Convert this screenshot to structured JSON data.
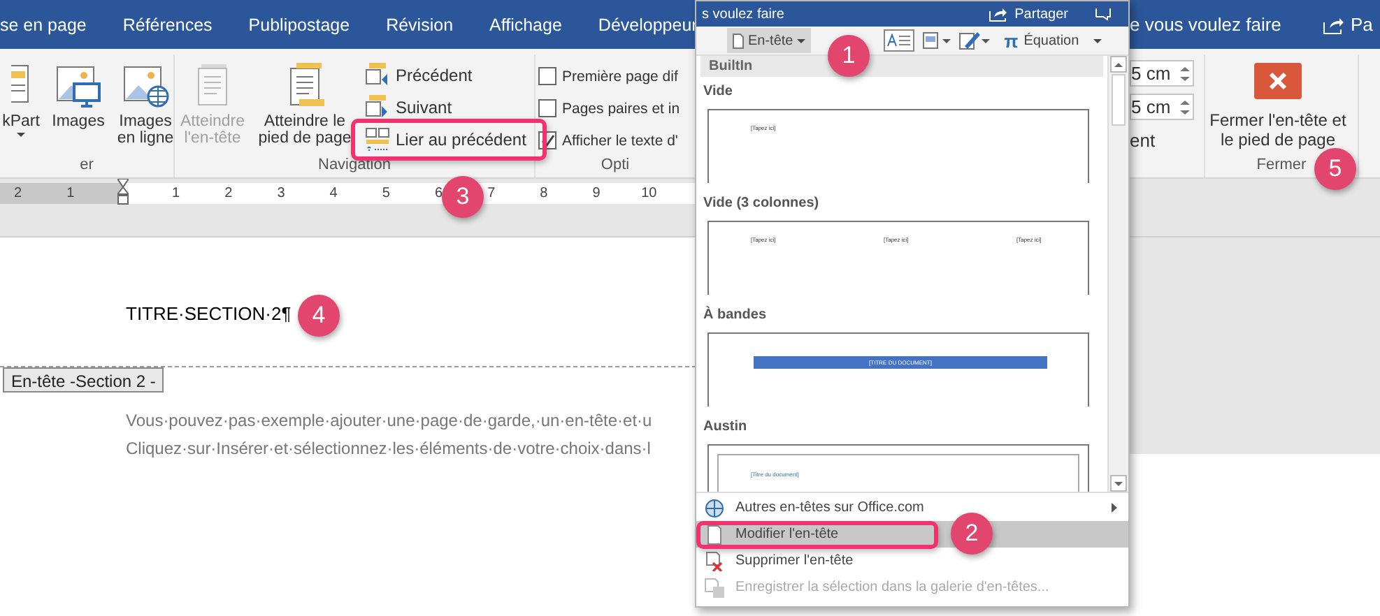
{
  "tabs": [
    {
      "label": "se en page"
    },
    {
      "label": "Références"
    },
    {
      "label": "Publipostage"
    },
    {
      "label": "Révision"
    },
    {
      "label": "Affichage"
    },
    {
      "label": "Développeur"
    }
  ],
  "tell_me": "e vous voulez faire",
  "share": "Pa",
  "ribbon": {
    "groups": [
      {
        "kind": "insert",
        "label": "er",
        "buttons": [
          {
            "label": "kPart",
            "dropdown": true
          },
          {
            "label": "Images",
            "dropdown": false
          },
          {
            "label": "Images en ligne",
            "dropdown": false
          }
        ]
      },
      {
        "kind": "navigation",
        "label": "Navigation",
        "large_buttons": [
          {
            "label": "Atteindre l'en-tête",
            "disabled": true
          },
          {
            "label": "Atteindre le pied de page",
            "disabled": false
          }
        ],
        "small_buttons": [
          {
            "label": "Précédent"
          },
          {
            "label": "Suivant"
          },
          {
            "label": "Lier au précédent"
          }
        ]
      },
      {
        "kind": "options",
        "label": "Opti",
        "checkboxes": [
          {
            "label": "Première page dif",
            "checked": false
          },
          {
            "label": "Pages paires et in",
            "checked": false
          },
          {
            "label": "Afficher le texte d'",
            "checked": true
          }
        ]
      },
      {
        "kind": "position",
        "fields": [
          {
            "value": "5 cm"
          },
          {
            "value": "5 cm"
          }
        ],
        "note": "ent"
      },
      {
        "kind": "close",
        "label": "Fermer",
        "button": "Fermer l'en-tête et le pied de page"
      }
    ]
  },
  "ruler": {
    "left_numbers": [
      "2",
      "1"
    ],
    "numbers": [
      "1",
      "2",
      "3",
      "4",
      "5",
      "6",
      "7",
      "8",
      "9",
      "10"
    ]
  },
  "document": {
    "title": "TITRE·SECTION·2¶",
    "header_tag": "En-tête -Section 2 -",
    "paragraph_lines": [
      "Vous·pouvez·pas·exemple·ajouter·une·page·de·garde,·un·en-tête·et·u",
      "Cliquez·sur·Insérer·et·sélectionnez·les·éléments·de·votre·choix·dans·l"
    ]
  },
  "popup": {
    "title_hint": "s voulez faire",
    "share": "Partager",
    "header_button": "En-tête",
    "equation_symbol": "π",
    "equation": "Équation",
    "gallery": {
      "category": "BuiltIn",
      "items": [
        {
          "name": "Vide",
          "kind": "blank",
          "placeholders": [
            "[Tapez ici]"
          ]
        },
        {
          "name": "Vide (3 colonnes)",
          "kind": "three_columns",
          "placeholders": [
            "[Tapez ici]",
            "[Tapez ici]",
            "[Tapez ici]"
          ]
        },
        {
          "name": "À bandes",
          "kind": "banded",
          "placeholders": [
            "[TITRE DU DOCUMENT]"
          ]
        },
        {
          "name": "Austin",
          "kind": "austin",
          "placeholders": [
            "[Titre du document]"
          ]
        }
      ]
    },
    "menu": [
      {
        "label": "Autres en-têtes sur Office.com",
        "kind": "more",
        "submenu": true,
        "selected": false,
        "disabled": false
      },
      {
        "label": "Modifier l'en-tête",
        "kind": "edit",
        "submenu": false,
        "selected": true,
        "disabled": false
      },
      {
        "label": "Supprimer l'en-tête",
        "kind": "remove",
        "submenu": false,
        "selected": false,
        "disabled": false
      },
      {
        "label": "Enregistrer la sélection dans la galerie d'en-têtes...",
        "kind": "save",
        "submenu": false,
        "selected": false,
        "disabled": true
      }
    ]
  },
  "annotations": [
    {
      "label": "1"
    },
    {
      "label": "2"
    },
    {
      "label": "3"
    },
    {
      "label": "4"
    },
    {
      "label": "5"
    }
  ]
}
